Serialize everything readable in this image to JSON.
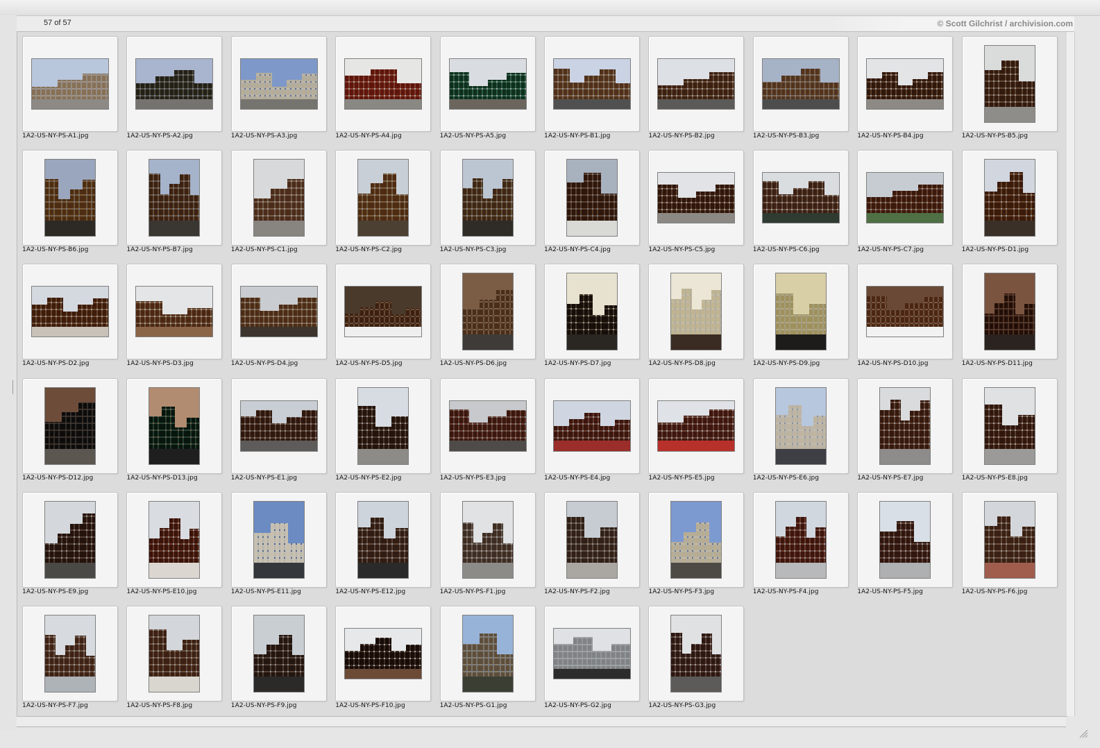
{
  "window": {
    "status_count": "57 of 57",
    "credit": "© Scott Gilchrist / archivision.com"
  },
  "thumbnails": [
    {
      "file": "1A2-US-NY-PS-A1.jpg",
      "orientation": "landscape",
      "palette": [
        "#b9c7dc",
        "#b9a996",
        "#8d8a86"
      ]
    },
    {
      "file": "1A2-US-NY-PS-A2.jpg",
      "orientation": "landscape",
      "palette": [
        "#a9b4cf",
        "#5e5a4c",
        "#757370"
      ]
    },
    {
      "file": "1A2-US-NY-PS-A3.jpg",
      "orientation": "landscape",
      "palette": [
        "#7e99c9",
        "#d7d2c6",
        "#76746f"
      ]
    },
    {
      "file": "1A2-US-NY-PS-A4.jpg",
      "orientation": "landscape",
      "palette": [
        "#e6e6e4",
        "#9b4a37",
        "#8a8883"
      ]
    },
    {
      "file": "1A2-US-NY-PS-A5.jpg",
      "orientation": "landscape",
      "palette": [
        "#d9dde1",
        "#3a6e54",
        "#6b655d"
      ]
    },
    {
      "file": "1A2-US-NY-PS-B1.jpg",
      "orientation": "landscape",
      "palette": [
        "#c9d3e4",
        "#8f6f51",
        "#505050"
      ]
    },
    {
      "file": "1A2-US-NY-PS-B2.jpg",
      "orientation": "landscape",
      "palette": [
        "#dde0e5",
        "#7b5a42",
        "#5b5a59"
      ]
    },
    {
      "file": "1A2-US-NY-PS-B3.jpg",
      "orientation": "landscape",
      "palette": [
        "#a6b3c7",
        "#907257",
        "#4d4d4d"
      ]
    },
    {
      "file": "1A2-US-NY-PS-B4.jpg",
      "orientation": "landscape",
      "palette": [
        "#e2e4e6",
        "#6f4d36",
        "#8d8a85"
      ]
    },
    {
      "file": "1A2-US-NY-PS-B5.jpg",
      "orientation": "portrait",
      "palette": [
        "#dadcdc",
        "#71523b",
        "#8f8d89"
      ]
    },
    {
      "file": "1A2-US-NY-PS-B6.jpg",
      "orientation": "portrait",
      "palette": [
        "#9aa6bd",
        "#8b6a44",
        "#2d2a26"
      ]
    },
    {
      "file": "1A2-US-NY-PS-B7.jpg",
      "orientation": "portrait",
      "palette": [
        "#a5b3cb",
        "#7a5c43",
        "#3a3632"
      ]
    },
    {
      "file": "1A2-US-NY-PS-C1.jpg",
      "orientation": "portrait",
      "palette": [
        "#d7d9da",
        "#8a6a52",
        "#888480"
      ]
    },
    {
      "file": "1A2-US-NY-PS-C2.jpg",
      "orientation": "portrait",
      "palette": [
        "#c9cfd6",
        "#8c6a45",
        "#4c4032"
      ]
    },
    {
      "file": "1A2-US-NY-PS-C3.jpg",
      "orientation": "portrait",
      "palette": [
        "#bcc6d3",
        "#7d6347",
        "#2f2b27"
      ]
    },
    {
      "file": "1A2-US-NY-PS-C4.jpg",
      "orientation": "portrait",
      "palette": [
        "#a8b2bf",
        "#6b4b37",
        "#d9d9d6"
      ]
    },
    {
      "file": "1A2-US-NY-PS-C5.jpg",
      "orientation": "landscape",
      "palette": [
        "#e1e3e6",
        "#6d4b36",
        "#8c8984"
      ]
    },
    {
      "file": "1A2-US-NY-PS-C6.jpg",
      "orientation": "landscape",
      "palette": [
        "#dadde0",
        "#7a5945",
        "#2f3a31"
      ]
    },
    {
      "file": "1A2-US-NY-PS-C7.jpg",
      "orientation": "landscape",
      "palette": [
        "#c7ccd3",
        "#7a4e37",
        "#4f6f44"
      ]
    },
    {
      "file": "1A2-US-NY-PS-D1.jpg",
      "orientation": "portrait",
      "palette": [
        "#d1d6df",
        "#7a5234",
        "#3a3028"
      ]
    },
    {
      "file": "1A2-US-NY-PS-D2.jpg",
      "orientation": "landscape",
      "palette": [
        "#d4d9e0",
        "#7e5435",
        "#c8c2b8"
      ]
    },
    {
      "file": "1A2-US-NY-PS-D3.jpg",
      "orientation": "landscape",
      "palette": [
        "#e4e5e6",
        "#8a6446",
        "#8b6548"
      ]
    },
    {
      "file": "1A2-US-NY-PS-D4.jpg",
      "orientation": "landscape",
      "palette": [
        "#c9ccd0",
        "#8b6a4c",
        "#3c352d"
      ]
    },
    {
      "file": "1A2-US-NY-PS-D5.jpg",
      "orientation": "landscape",
      "palette": [
        "#4a3a2c",
        "#7d5a40",
        "#efefef"
      ]
    },
    {
      "file": "1A2-US-NY-PS-D6.jpg",
      "orientation": "portrait",
      "palette": [
        "#7b5c44",
        "#8a6c52",
        "#3f3b38"
      ]
    },
    {
      "file": "1A2-US-NY-PS-D7.jpg",
      "orientation": "portrait",
      "palette": [
        "#e7e2cf",
        "#4a3c2f",
        "#2a2622"
      ]
    },
    {
      "file": "1A2-US-NY-PS-D8.jpg",
      "orientation": "portrait",
      "palette": [
        "#ebe6d5",
        "#ddd6c0",
        "#3a2c22"
      ]
    },
    {
      "file": "1A2-US-NY-PS-D9.jpg",
      "orientation": "portrait",
      "palette": [
        "#d8cfa6",
        "#c9c09a",
        "#1e1c1a"
      ]
    },
    {
      "file": "1A2-US-NY-PS-D10.jpg",
      "orientation": "landscape",
      "palette": [
        "#6a4a36",
        "#8a6348",
        "#f2f2f2"
      ]
    },
    {
      "file": "1A2-US-NY-PS-D11.jpg",
      "orientation": "portrait",
      "palette": [
        "#7b5440",
        "#5d3c2b",
        "#2b2320"
      ]
    },
    {
      "file": "1A2-US-NY-PS-D12.jpg",
      "orientation": "portrait",
      "palette": [
        "#6d4c3a",
        "#3b3835",
        "#5c5650"
      ]
    },
    {
      "file": "1A2-US-NY-PS-D13.jpg",
      "orientation": "portrait",
      "palette": [
        "#b28c70",
        "#2e4a3a",
        "#1f1f1f"
      ]
    },
    {
      "file": "1A2-US-NY-PS-E1.jpg",
      "orientation": "landscape",
      "palette": [
        "#c8ced4",
        "#6c4d3c",
        "#5e5c5a"
      ]
    },
    {
      "file": "1A2-US-NY-PS-E2.jpg",
      "orientation": "portrait",
      "palette": [
        "#d7dce3",
        "#5e4536",
        "#8d8b88"
      ]
    },
    {
      "file": "1A2-US-NY-PS-E3.jpg",
      "orientation": "landscape",
      "palette": [
        "#c7c9cc",
        "#7a4c3c",
        "#4e4b49"
      ]
    },
    {
      "file": "1A2-US-NY-PS-E4.jpg",
      "orientation": "landscape",
      "palette": [
        "#cfd6e1",
        "#7b4a3a",
        "#9b2d2a"
      ]
    },
    {
      "file": "1A2-US-NY-PS-E5.jpg",
      "orientation": "landscape",
      "palette": [
        "#dfe2e6",
        "#7d4d3d",
        "#b8302a"
      ]
    },
    {
      "file": "1A2-US-NY-PS-E6.jpg",
      "orientation": "portrait",
      "palette": [
        "#b7c7de",
        "#dcd6cb",
        "#3d3f45"
      ]
    },
    {
      "file": "1A2-US-NY-PS-E7.jpg",
      "orientation": "portrait",
      "palette": [
        "#d9dbdc",
        "#74503d",
        "#8d8c8a"
      ]
    },
    {
      "file": "1A2-US-NY-PS-E8.jpg",
      "orientation": "portrait",
      "palette": [
        "#dfe1e3",
        "#6e4c3a",
        "#9c9a98"
      ]
    },
    {
      "file": "1A2-US-NY-PS-E9.jpg",
      "orientation": "portrait",
      "palette": [
        "#d4d8dc",
        "#5f4638",
        "#4b4946"
      ]
    },
    {
      "file": "1A2-US-NY-PS-E10.jpg",
      "orientation": "portrait",
      "palette": [
        "#d9dde2",
        "#7a4532",
        "#dcd6d0"
      ]
    },
    {
      "file": "1A2-US-NY-PS-E11.jpg",
      "orientation": "portrait",
      "palette": [
        "#6b8bc2",
        "#e1ddd4",
        "#34373b"
      ]
    },
    {
      "file": "1A2-US-NY-PS-E12.jpg",
      "orientation": "portrait",
      "palette": [
        "#ced4dc",
        "#6f5444",
        "#2a2a2a"
      ]
    },
    {
      "file": "1A2-US-NY-PS-F1.jpg",
      "orientation": "portrait",
      "palette": [
        "#e0e2e4",
        "#7d6a5d",
        "#8d8b88"
      ]
    },
    {
      "file": "1A2-US-NY-PS-F2.jpg",
      "orientation": "portrait",
      "palette": [
        "#c6ccd2",
        "#6f5a4c",
        "#aaa7a2"
      ]
    },
    {
      "file": "1A2-US-NY-PS-F3.jpg",
      "orientation": "portrait",
      "palette": [
        "#7d9ad0",
        "#d8d2c2",
        "#4d4a45"
      ]
    },
    {
      "file": "1A2-US-NY-PS-F4.jpg",
      "orientation": "portrait",
      "palette": [
        "#d1d7de",
        "#7e4a3a",
        "#b7b9bb"
      ]
    },
    {
      "file": "1A2-US-NY-PS-F5.jpg",
      "orientation": "portrait",
      "palette": [
        "#d9dfe6",
        "#6d4b3d",
        "#aeb0b2"
      ]
    },
    {
      "file": "1A2-US-NY-PS-F6.jpg",
      "orientation": "portrait",
      "palette": [
        "#d3d7dc",
        "#7a5b47",
        "#a05d4e"
      ]
    },
    {
      "file": "1A2-US-NY-PS-F7.jpg",
      "orientation": "portrait",
      "palette": [
        "#d7dbe0",
        "#7d5d4a",
        "#aeb3b7"
      ]
    },
    {
      "file": "1A2-US-NY-PS-F8.jpg",
      "orientation": "portrait",
      "palette": [
        "#d3d7db",
        "#7b5b46",
        "#d9d6d0"
      ]
    },
    {
      "file": "1A2-US-NY-PS-F9.jpg",
      "orientation": "portrait",
      "palette": [
        "#c9ced3",
        "#5f4a3d",
        "#2b2a29"
      ]
    },
    {
      "file": "1A2-US-NY-PS-F10.jpg",
      "orientation": "landscape",
      "palette": [
        "#e6e8ea",
        "#4a3429",
        "#6b4a36"
      ]
    },
    {
      "file": "1A2-US-NY-PS-G1.jpg",
      "orientation": "portrait",
      "palette": [
        "#98b3d8",
        "#9a8d7c",
        "#3b3f33"
      ]
    },
    {
      "file": "1A2-US-NY-PS-G2.jpg",
      "orientation": "landscape",
      "palette": [
        "#dfe1e4",
        "#b4b7b8",
        "#2c2c2c"
      ]
    },
    {
      "file": "1A2-US-NY-PS-G3.jpg",
      "orientation": "portrait",
      "palette": [
        "#dfe1e3",
        "#6a4d43",
        "#5c5b5a"
      ]
    }
  ]
}
